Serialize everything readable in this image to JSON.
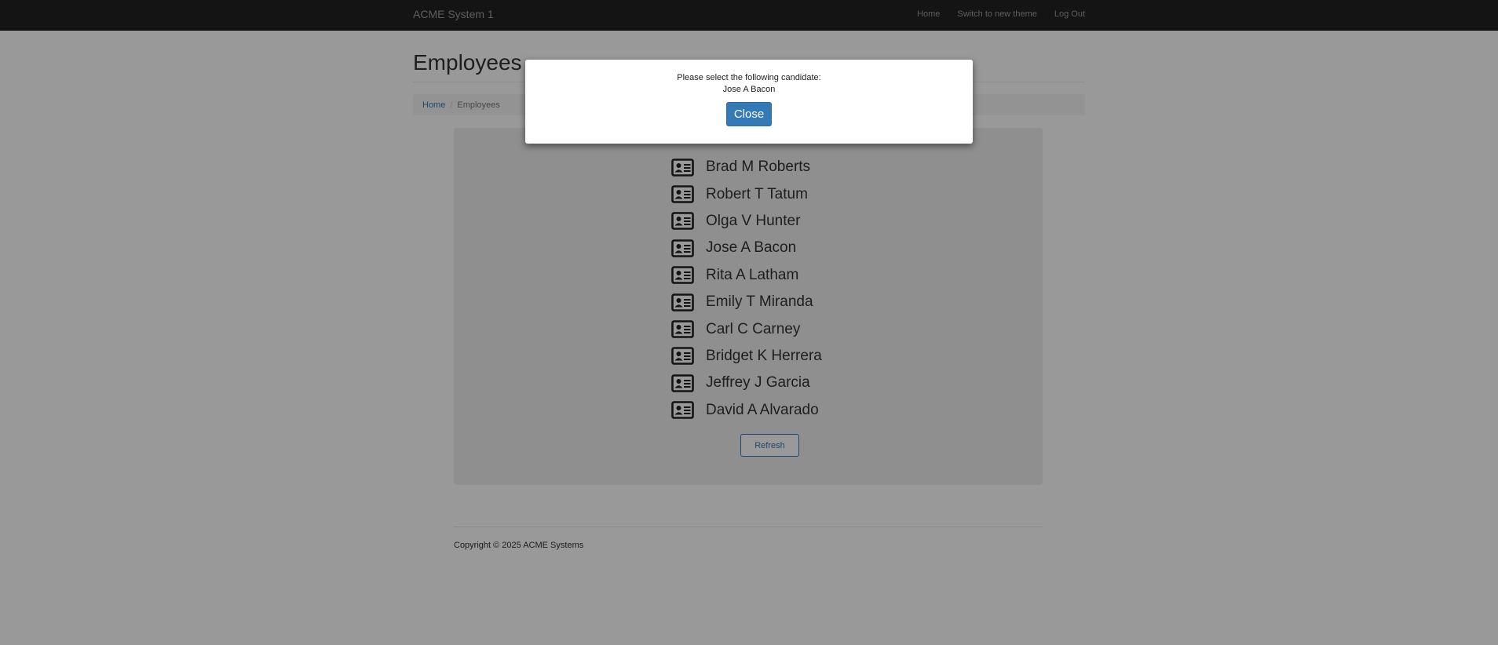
{
  "navbar": {
    "brand": "ACME System 1",
    "links": [
      "Home",
      "Switch to new theme",
      "Log Out"
    ]
  },
  "page": {
    "title": "Employees",
    "breadcrumb": {
      "home": "Home",
      "current": "Employees"
    }
  },
  "employees": [
    "Brad M Roberts",
    "Robert T Tatum",
    "Olga V Hunter",
    "Jose A Bacon",
    "Rita A Latham",
    "Emily T Miranda",
    "Carl C Carney",
    "Bridget K Herrera",
    "Jeffrey J Garcia",
    "David A Alvarado"
  ],
  "refresh_label": "Refresh",
  "footer": {
    "copyright": "Copyright © 2025 ACME Systems"
  },
  "modal": {
    "message": "Please select the following candidate:",
    "candidate": "Jose A Bacon",
    "close_label": "Close"
  },
  "icons": {
    "employee": "id-card-icon"
  },
  "colors": {
    "navbar_bg": "#222222",
    "primary": "#337ab7",
    "panel_bg": "#eeeeee"
  }
}
